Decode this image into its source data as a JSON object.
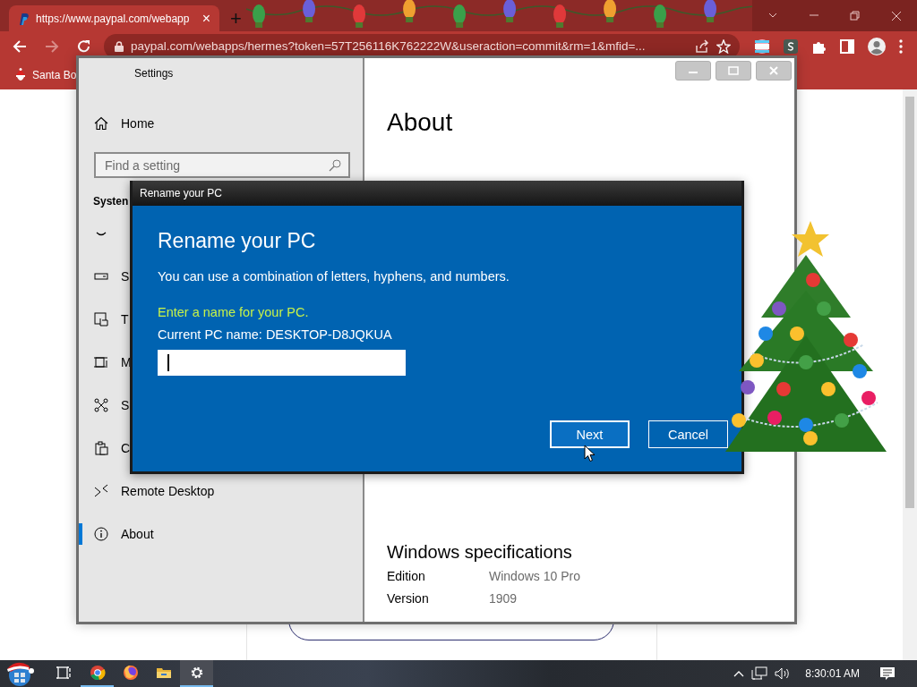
{
  "browser": {
    "tab": {
      "title": "https://www.paypal.com/webapp",
      "close": "×",
      "selected": true
    },
    "new_tab": "+",
    "nav": [
      {
        "kind": "back",
        "disabled": false
      },
      {
        "kind": "forward",
        "disabled": true
      },
      {
        "kind": "reload",
        "disabled": false
      }
    ],
    "address": "paypal.com/webapps/hermes?token=57T256116K762222W&useraction=commit&rm=1&mfid=...",
    "bookmarks": [
      {
        "label": "Santa Bo"
      }
    ]
  },
  "settings": {
    "title": "Settings",
    "home": "Home",
    "search": {
      "placeholder": "Find a setting"
    },
    "section": "Systen",
    "nav": [
      {
        "kind": "focus",
        "selected": false
      },
      {
        "kind": "storage",
        "label": "S",
        "selected": false
      },
      {
        "kind": "tablet",
        "label": "T",
        "selected": false
      },
      {
        "kind": "multitask",
        "label": "M",
        "selected": false
      },
      {
        "kind": "shared",
        "label": "S",
        "selected": false
      },
      {
        "kind": "clipboard",
        "label": "C",
        "selected": false
      },
      {
        "kind": "remote",
        "label": "Remote Desktop",
        "selected": false
      },
      {
        "kind": "about",
        "label": "About",
        "selected": true
      }
    ],
    "page_title": "About",
    "specs": {
      "heading": "Windows specifications",
      "rows": [
        {
          "label": "Edition",
          "value": "Windows 10 Pro"
        },
        {
          "label": "Version",
          "value": "1909"
        }
      ]
    }
  },
  "dialog": {
    "window_title": "Rename your PC",
    "heading": "Rename your PC",
    "description": "You can use a combination of letters, hyphens, and numbers.",
    "prompt": "Enter a name for your PC.",
    "current_name": "Current PC name: DESKTOP-D8JQKUA",
    "buttons": [
      {
        "label": "Next",
        "focused": true
      },
      {
        "label": "Cancel",
        "focused": false
      }
    ]
  },
  "taskbar": {
    "apps": [
      {
        "kind": "taskview",
        "running": false,
        "active": false
      },
      {
        "kind": "chrome",
        "running": true,
        "active": false
      },
      {
        "kind": "firefox",
        "running": false,
        "active": false
      },
      {
        "kind": "explorer",
        "running": false,
        "active": false
      },
      {
        "kind": "settings",
        "running": true,
        "active": true
      }
    ],
    "clock": "8:30:01 AM"
  }
}
